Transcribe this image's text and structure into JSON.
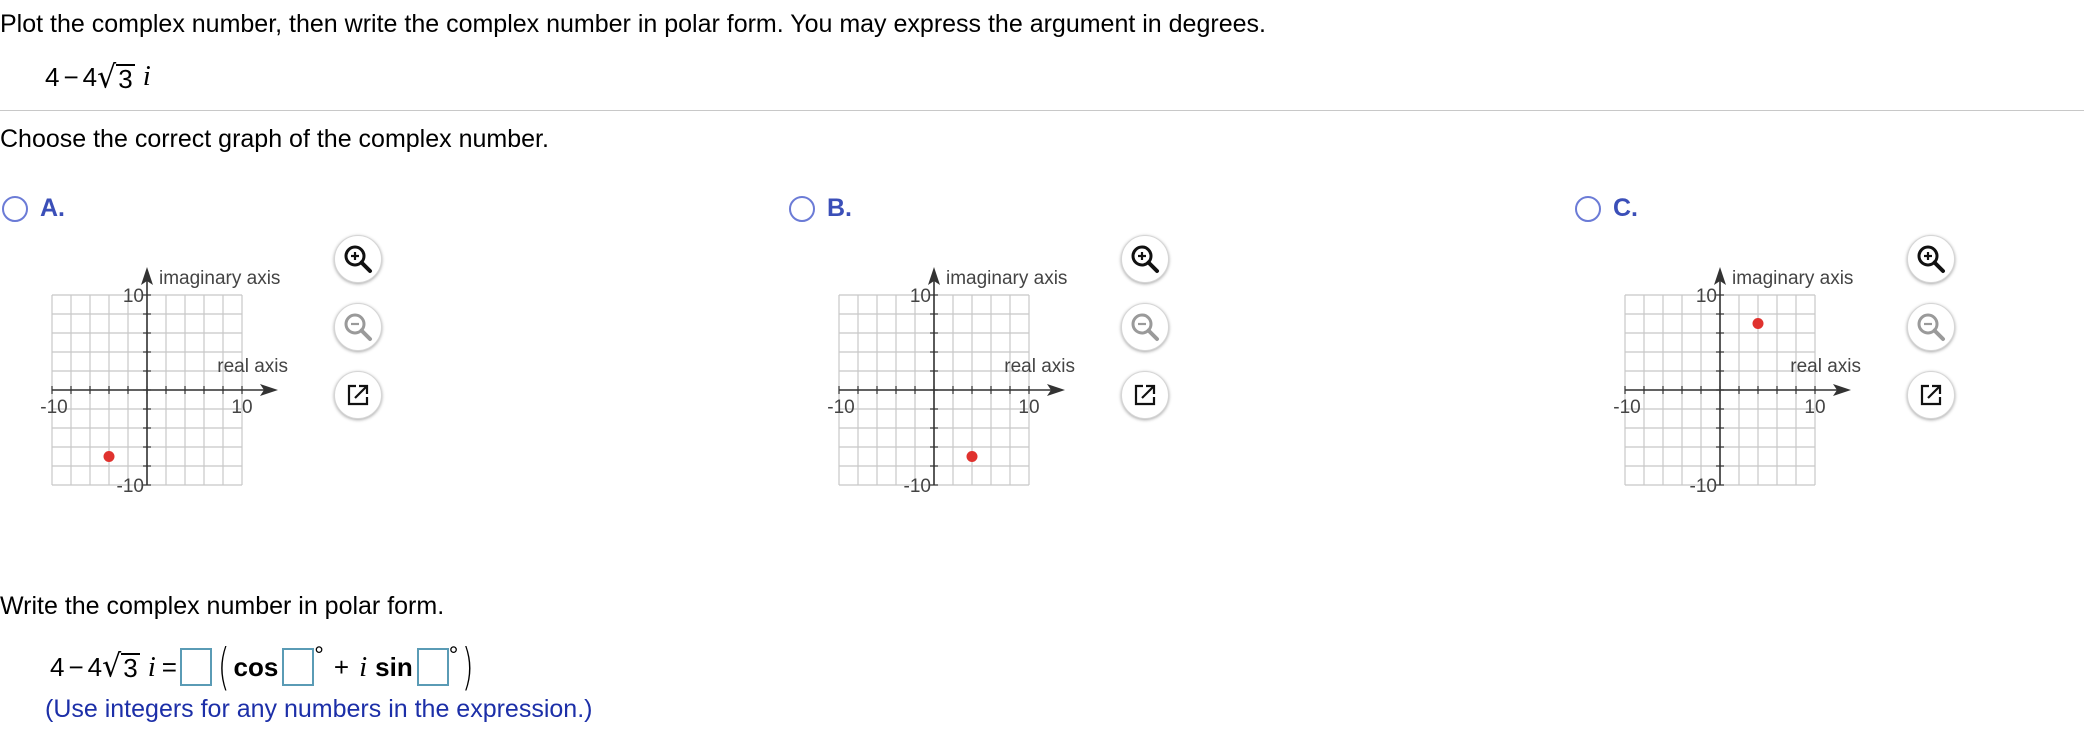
{
  "question": {
    "instruction": "Plot the complex number, then write the complex number in polar form. You may express the argument in degrees.",
    "expr": {
      "a": "4",
      "minus": "−",
      "coef": "4",
      "sqrt_sym": "√",
      "radicand": "3",
      "i": "i"
    }
  },
  "part1": {
    "prompt": "Choose the correct graph of the complex number.",
    "choices": [
      {
        "letter": "A.",
        "selected": false
      },
      {
        "letter": "B.",
        "selected": false
      },
      {
        "letter": "C.",
        "selected": false
      }
    ],
    "graph_labels": {
      "imaginary_axis": "imaginary axis",
      "real_axis": "real axis",
      "neg_ten": "-10",
      "pos_ten": "10",
      "neg_ten_y": "-10"
    }
  },
  "part2": {
    "prompt": "Write the complex number in polar form.",
    "equals": "=",
    "cos_label": "cos",
    "plus": "+",
    "sin_label": "sin",
    "degree": "°",
    "open_paren": "(",
    "close_paren": ")",
    "hint": "(Use integers for any numbers in the expression.)",
    "answers": {
      "r": "",
      "cos_angle": "",
      "sin_angle": ""
    }
  },
  "chart_data": [
    {
      "type": "scatter",
      "xlabel": "real axis",
      "ylabel": "imaginary axis",
      "xlim": [
        -10,
        10
      ],
      "ylim": [
        -10,
        10
      ],
      "grid": true,
      "points": [
        {
          "x": -4,
          "y": -7
        }
      ],
      "point_color": "#e0322e"
    },
    {
      "type": "scatter",
      "xlabel": "real axis",
      "ylabel": "imaginary axis",
      "xlim": [
        -10,
        10
      ],
      "ylim": [
        -10,
        10
      ],
      "grid": true,
      "points": [
        {
          "x": 4,
          "y": -7
        }
      ],
      "point_color": "#e0322e"
    },
    {
      "type": "scatter",
      "xlabel": "real axis",
      "ylabel": "imaginary axis",
      "xlim": [
        -10,
        10
      ],
      "ylim": [
        -10,
        10
      ],
      "grid": true,
      "points": [
        {
          "x": 4,
          "y": 7
        }
      ],
      "point_color": "#e0322e"
    }
  ],
  "tools": {
    "zoom_in": "zoom-in-icon",
    "zoom_out": "zoom-out-icon",
    "popout": "popout-icon"
  },
  "colors": {
    "accent": "#3b4fb8",
    "hint": "#1c2fa8",
    "point": "#e0322e",
    "grid": "#c8c8c8"
  }
}
